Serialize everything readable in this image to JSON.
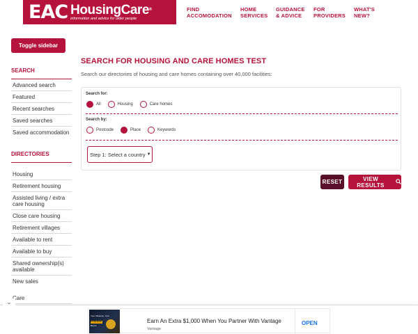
{
  "header": {
    "logo_mark": "EAC",
    "logo_name": "HousingCare",
    "logo_registered": "®",
    "logo_tagline": "information and advice for older people",
    "nav": [
      {
        "line1": "FIND",
        "line2": "ACCOMODATION"
      },
      {
        "line1": "HOME",
        "line2": "SERVICES"
      },
      {
        "line1": "GUIDANCE",
        "line2": "& ADVICE"
      },
      {
        "line1": "FOR",
        "line2": "PROVIDERS"
      },
      {
        "line1": "WHAT'S",
        "line2": "NEW?"
      }
    ]
  },
  "toggle_sidebar": "Toggle sidebar",
  "sidebar": {
    "search_heading": "SEARCH",
    "search_links": [
      "Advanced search",
      "Featured",
      "Recent searches",
      "Saved searches",
      "Saved accommodation"
    ],
    "directories_heading": "DIRECTORIES",
    "directory_links": [
      "Housing",
      "Retirement housing",
      "Assisted living / extra care housing",
      "Close care housing",
      "Retirement villages",
      "Available to rent",
      "Available to buy",
      "Shared ownership(s) available",
      "New sales",
      "Care"
    ]
  },
  "main": {
    "title": "SEARCH FOR HOUSING AND CARE HOMES TEST",
    "intro": "Search our directories of housing and care homes containing over 40,000 facilities:",
    "search_for_label": "Search for:",
    "search_for_options": [
      {
        "label": "All",
        "checked": true
      },
      {
        "label": "Housing",
        "checked": false
      },
      {
        "label": "Care homes",
        "checked": false
      }
    ],
    "search_by_label": "Search by:",
    "search_by_options": [
      {
        "label": "Postcode",
        "checked": false
      },
      {
        "label": "Place",
        "checked": true
      },
      {
        "label": "Keywords",
        "checked": false
      }
    ],
    "country_select": "Step 1: Select a country",
    "reset_button": "RESET",
    "view_results_button": "VIEW RESULTS"
  },
  "ad": {
    "image_line1": "Your Influence. Your",
    "image_badge": "EXTRA $1000",
    "image_line3": "Bonus",
    "title": "Earn An Extra $1,000 When You Partner With Vantage",
    "sponsor": "Vantage",
    "cta": "OPEN"
  },
  "colors": {
    "brand": "#b5123c",
    "reset": "#5a0f2a",
    "ad_cta": "#1a73e8"
  }
}
